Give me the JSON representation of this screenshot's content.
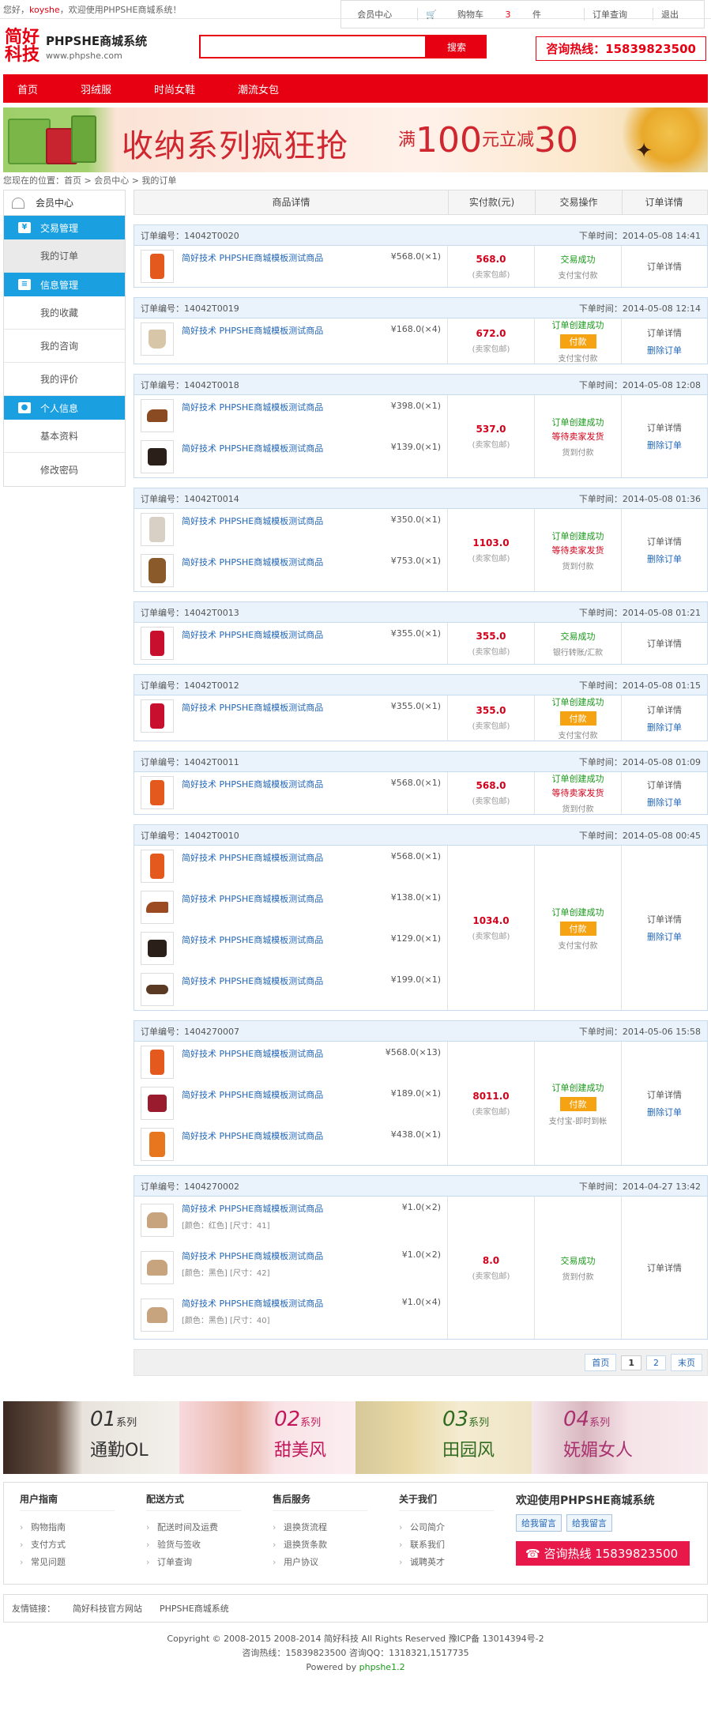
{
  "topbar": {
    "greeting": "您好，",
    "username": "koyshe",
    "welcome": "，欢迎使用PHPSHE商城系统！",
    "member": "会员中心",
    "cart_prefix": "购物车",
    "cart_count": "3",
    "cart_suffix": "件",
    "order_query": "订单查询",
    "logout": "退出"
  },
  "header": {
    "logo_cn": "简好科技",
    "logo_title": "PHPSHE商城系统",
    "logo_url": "www.phpshe.com",
    "search_placeholder": "",
    "search_button": "搜索",
    "hotline": "咨询热线：15839823500"
  },
  "nav": [
    "首页",
    "羽绒服",
    "时尚女鞋",
    "潮流女包"
  ],
  "banner": {
    "title": "收纳系列疯狂抢",
    "promo_pre": "满",
    "promo_num1": "100",
    "promo_mid": "元立减",
    "promo_num2": "30"
  },
  "breadcrumb": "您现在的位置：首页 > 会员中心 > 我的订单",
  "sidebar": {
    "title": "会员中心",
    "groups": [
      {
        "label": "交易管理",
        "items": [
          "我的订单"
        ]
      },
      {
        "label": "信息管理",
        "items": [
          "我的收藏",
          "我的咨询",
          "我的评价"
        ]
      },
      {
        "label": "个人信息",
        "items": [
          "基本资料",
          "修改密码"
        ]
      }
    ]
  },
  "table": {
    "headers": [
      "商品详情",
      "实付款(元)",
      "交易操作",
      "订单详情"
    ]
  },
  "labels": {
    "order_no": "订单编号：",
    "order_time": "下单时间：",
    "ship": "(卖家包邮)",
    "detail": "订单详情",
    "delete": "删除订单",
    "pay": "付款"
  },
  "orders": [
    {
      "no": "14042T0020",
      "time": "2014-05-08 14:41",
      "amount": "568.0",
      "status": "交易成功",
      "status2": "",
      "pay": false,
      "method": "支付宝付款",
      "delete": false,
      "items": [
        {
          "name": "简好技术 PHPSHE商城模板测试商品",
          "price": "¥568.0(×1)",
          "img": "coat"
        }
      ]
    },
    {
      "no": "14042T0019",
      "time": "2014-05-08 12:14",
      "amount": "672.0",
      "status": "订单创建成功",
      "status2": "",
      "pay": true,
      "method": "支付宝付款",
      "delete": true,
      "items": [
        {
          "name": "简好技术 PHPSHE商城模板测试商品",
          "price": "¥168.0(×4)",
          "img": "boot"
        }
      ]
    },
    {
      "no": "14042T0018",
      "time": "2014-05-08 12:08",
      "amount": "537.0",
      "status": "订单创建成功",
      "status2": "等待卖家发货",
      "pay": false,
      "method": "货到付款",
      "delete": true,
      "items": [
        {
          "name": "简好技术 PHPSHE商城模板测试商品",
          "price": "¥398.0(×1)",
          "img": "shoe"
        },
        {
          "name": "简好技术 PHPSHE商城模板测试商品",
          "price": "¥139.0(×1)",
          "img": "bag"
        }
      ]
    },
    {
      "no": "14042T0014",
      "time": "2014-05-08 01:36",
      "amount": "1103.0",
      "status": "订单创建成功",
      "status2": "等待卖家发货",
      "pay": false,
      "method": "货到付款",
      "delete": true,
      "items": [
        {
          "name": "简好技术 PHPSHE商城模板测试商品",
          "price": "¥350.0(×1)",
          "img": "jacket"
        },
        {
          "name": "简好技术 PHPSHE商城模板测试商品",
          "price": "¥753.0(×1)",
          "img": "fur"
        }
      ]
    },
    {
      "no": "14042T0013",
      "time": "2014-05-08 01:21",
      "amount": "355.0",
      "status": "交易成功",
      "status2": "",
      "pay": false,
      "method": "银行转账/汇款",
      "delete": false,
      "items": [
        {
          "name": "简好技术 PHPSHE商城模板测试商品",
          "price": "¥355.0(×1)",
          "img": "redcoat"
        }
      ]
    },
    {
      "no": "14042T0012",
      "time": "2014-05-08 01:15",
      "amount": "355.0",
      "status": "订单创建成功",
      "status2": "",
      "pay": true,
      "method": "支付宝付款",
      "delete": true,
      "items": [
        {
          "name": "简好技术 PHPSHE商城模板测试商品",
          "price": "¥355.0(×1)",
          "img": "redcoat"
        }
      ]
    },
    {
      "no": "14042T0011",
      "time": "2014-05-08 01:09",
      "amount": "568.0",
      "status": "订单创建成功",
      "status2": "等待卖家发货",
      "pay": false,
      "method": "货到付款",
      "delete": true,
      "items": [
        {
          "name": "简好技术 PHPSHE商城模板测试商品",
          "price": "¥568.0(×1)",
          "img": "coat"
        }
      ]
    },
    {
      "no": "14042T0010",
      "time": "2014-05-08 00:45",
      "amount": "1034.0",
      "status": "订单创建成功",
      "status2": "",
      "pay": true,
      "method": "支付宝付款",
      "delete": true,
      "items": [
        {
          "name": "简好技术 PHPSHE商城模板测试商品",
          "price": "¥568.0(×1)",
          "img": "coat"
        },
        {
          "name": "简好技术 PHPSHE商城模板测试商品",
          "price": "¥138.0(×1)",
          "img": "heel"
        },
        {
          "name": "简好技术 PHPSHE商城模板测试商品",
          "price": "¥129.0(×1)",
          "img": "bag"
        },
        {
          "name": "简好技术 PHPSHE商城模板测试商品",
          "price": "¥199.0(×1)",
          "img": "flat"
        }
      ]
    },
    {
      "no": "1404270007",
      "time": "2014-05-06 15:58",
      "amount": "8011.0",
      "status": "订单创建成功",
      "status2": "",
      "pay": true,
      "method": "支付宝-即时到帐",
      "delete": true,
      "items": [
        {
          "name": "简好技术 PHPSHE商城模板测试商品",
          "price": "¥568.0(×13)",
          "img": "coat"
        },
        {
          "name": "简好技术 PHPSHE商城模板测试商品",
          "price": "¥189.0(×1)",
          "img": "redbag"
        },
        {
          "name": "简好技术 PHPSHE商城模板测试商品",
          "price": "¥438.0(×1)",
          "img": "orange"
        }
      ]
    },
    {
      "no": "1404270002",
      "time": "2014-04-27 13:42",
      "amount": "8.0",
      "status": "交易成功",
      "status2": "",
      "pay": false,
      "method": "货到付款",
      "delete": false,
      "items": [
        {
          "name": "简好技术 PHPSHE商城模板测试商品",
          "attr": "[颜色：红色]  [尺寸：41]",
          "price": "¥1.0(×2)",
          "img": "tan"
        },
        {
          "name": "简好技术 PHPSHE商城模板测试商品",
          "attr": "[颜色：黑色]  [尺寸：42]",
          "price": "¥1.0(×2)",
          "img": "tan"
        },
        {
          "name": "简好技术 PHPSHE商城模板测试商品",
          "attr": "[颜色：黑色]  [尺寸：40]",
          "price": "¥1.0(×4)",
          "img": "tan"
        }
      ]
    }
  ],
  "pager": [
    "首页",
    "1",
    "2",
    "末页"
  ],
  "series": [
    {
      "num": "01",
      "word": "系列",
      "caption": "通勤OL"
    },
    {
      "num": "02",
      "word": "系列",
      "caption": "甜美风"
    },
    {
      "num": "03",
      "word": "系列",
      "caption": "田园风"
    },
    {
      "num": "04",
      "word": "系列",
      "caption": "妩媚女人"
    }
  ],
  "footer": {
    "cols": [
      {
        "title": "用户指南",
        "items": [
          "购物指南",
          "支付方式",
          "常见问题"
        ]
      },
      {
        "title": "配送方式",
        "items": [
          "配送时间及运费",
          "验货与签收",
          "订单查询"
        ]
      },
      {
        "title": "售后服务",
        "items": [
          "退换货流程",
          "退换货条款",
          "用户协议"
        ]
      },
      {
        "title": "关于我们",
        "items": [
          "公司简介",
          "联系我们",
          "诚聘英才"
        ]
      }
    ],
    "welcome": "欢迎使用PHPSHE商城系统",
    "msg_buttons": [
      "给我留言",
      "给我留言"
    ],
    "hotline": "咨询热线  15839823500"
  },
  "friend_links": {
    "label": "友情链接：",
    "items": [
      "简好科技官方网站",
      "PHPSHE商城系统"
    ]
  },
  "copyright": {
    "line1": "Copyright © 2008-2015 2008-2014 简好科技 All Rights Reserved   豫ICP备 13014394号-2",
    "line2": "咨询热线：15839823500   咨询QQ：1318321,1517735",
    "powered": "Powered by",
    "powered_link": "phpshe1.2"
  }
}
